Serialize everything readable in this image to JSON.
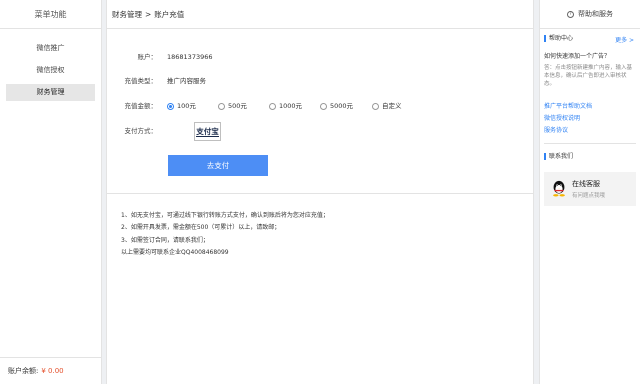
{
  "sidebar": {
    "title": "菜单功能",
    "items": [
      {
        "label": "微信推广"
      },
      {
        "label": "微信授权"
      },
      {
        "label": "财务管理"
      }
    ],
    "balance_label": "账户余额:",
    "balance_value": "¥ 0.00"
  },
  "breadcrumb": {
    "parent": "财务管理",
    "separator": ">",
    "current": "账户充值"
  },
  "form": {
    "account_label": "账户：",
    "account_value": "18681373966",
    "type_label": "充值类型：",
    "type_value": "推广内容服务",
    "amount_label": "充值金额：",
    "amount_options": [
      "100元",
      "500元",
      "1000元",
      "5000元",
      "自定义"
    ],
    "amount_selected": "100元",
    "method_label": "支付方式：",
    "method_logo": "支付宝",
    "pay_button": "去支付"
  },
  "notes": [
    "1、如无支付宝，可通过线下银行转账方式支付，确认到账后将为您对应充值；",
    "2、如需开具发票，需金额在500（可累计）以上，请致邮；",
    "3、如需签订合同，请联系我们；",
    "以上需要均可联系企业QQ4008468099"
  ],
  "help": {
    "title": "帮助和服务",
    "center_title": "帮助中心",
    "more": "更多 >",
    "question": "如何快速添加一个广告？",
    "answer": "答：点击按钮新建推广内容，输入基本信息，确认后广告即进入审核状态。",
    "links": [
      "推广平台帮助文档",
      "微信授权说明",
      "服务协议"
    ],
    "contact_title": "联系我们",
    "cs_title": "在线客服",
    "cs_sub": "有问题点我哦"
  },
  "colors": {
    "accent": "#4d8ef5",
    "link": "#2f82f4",
    "balance": "#e5512d"
  }
}
